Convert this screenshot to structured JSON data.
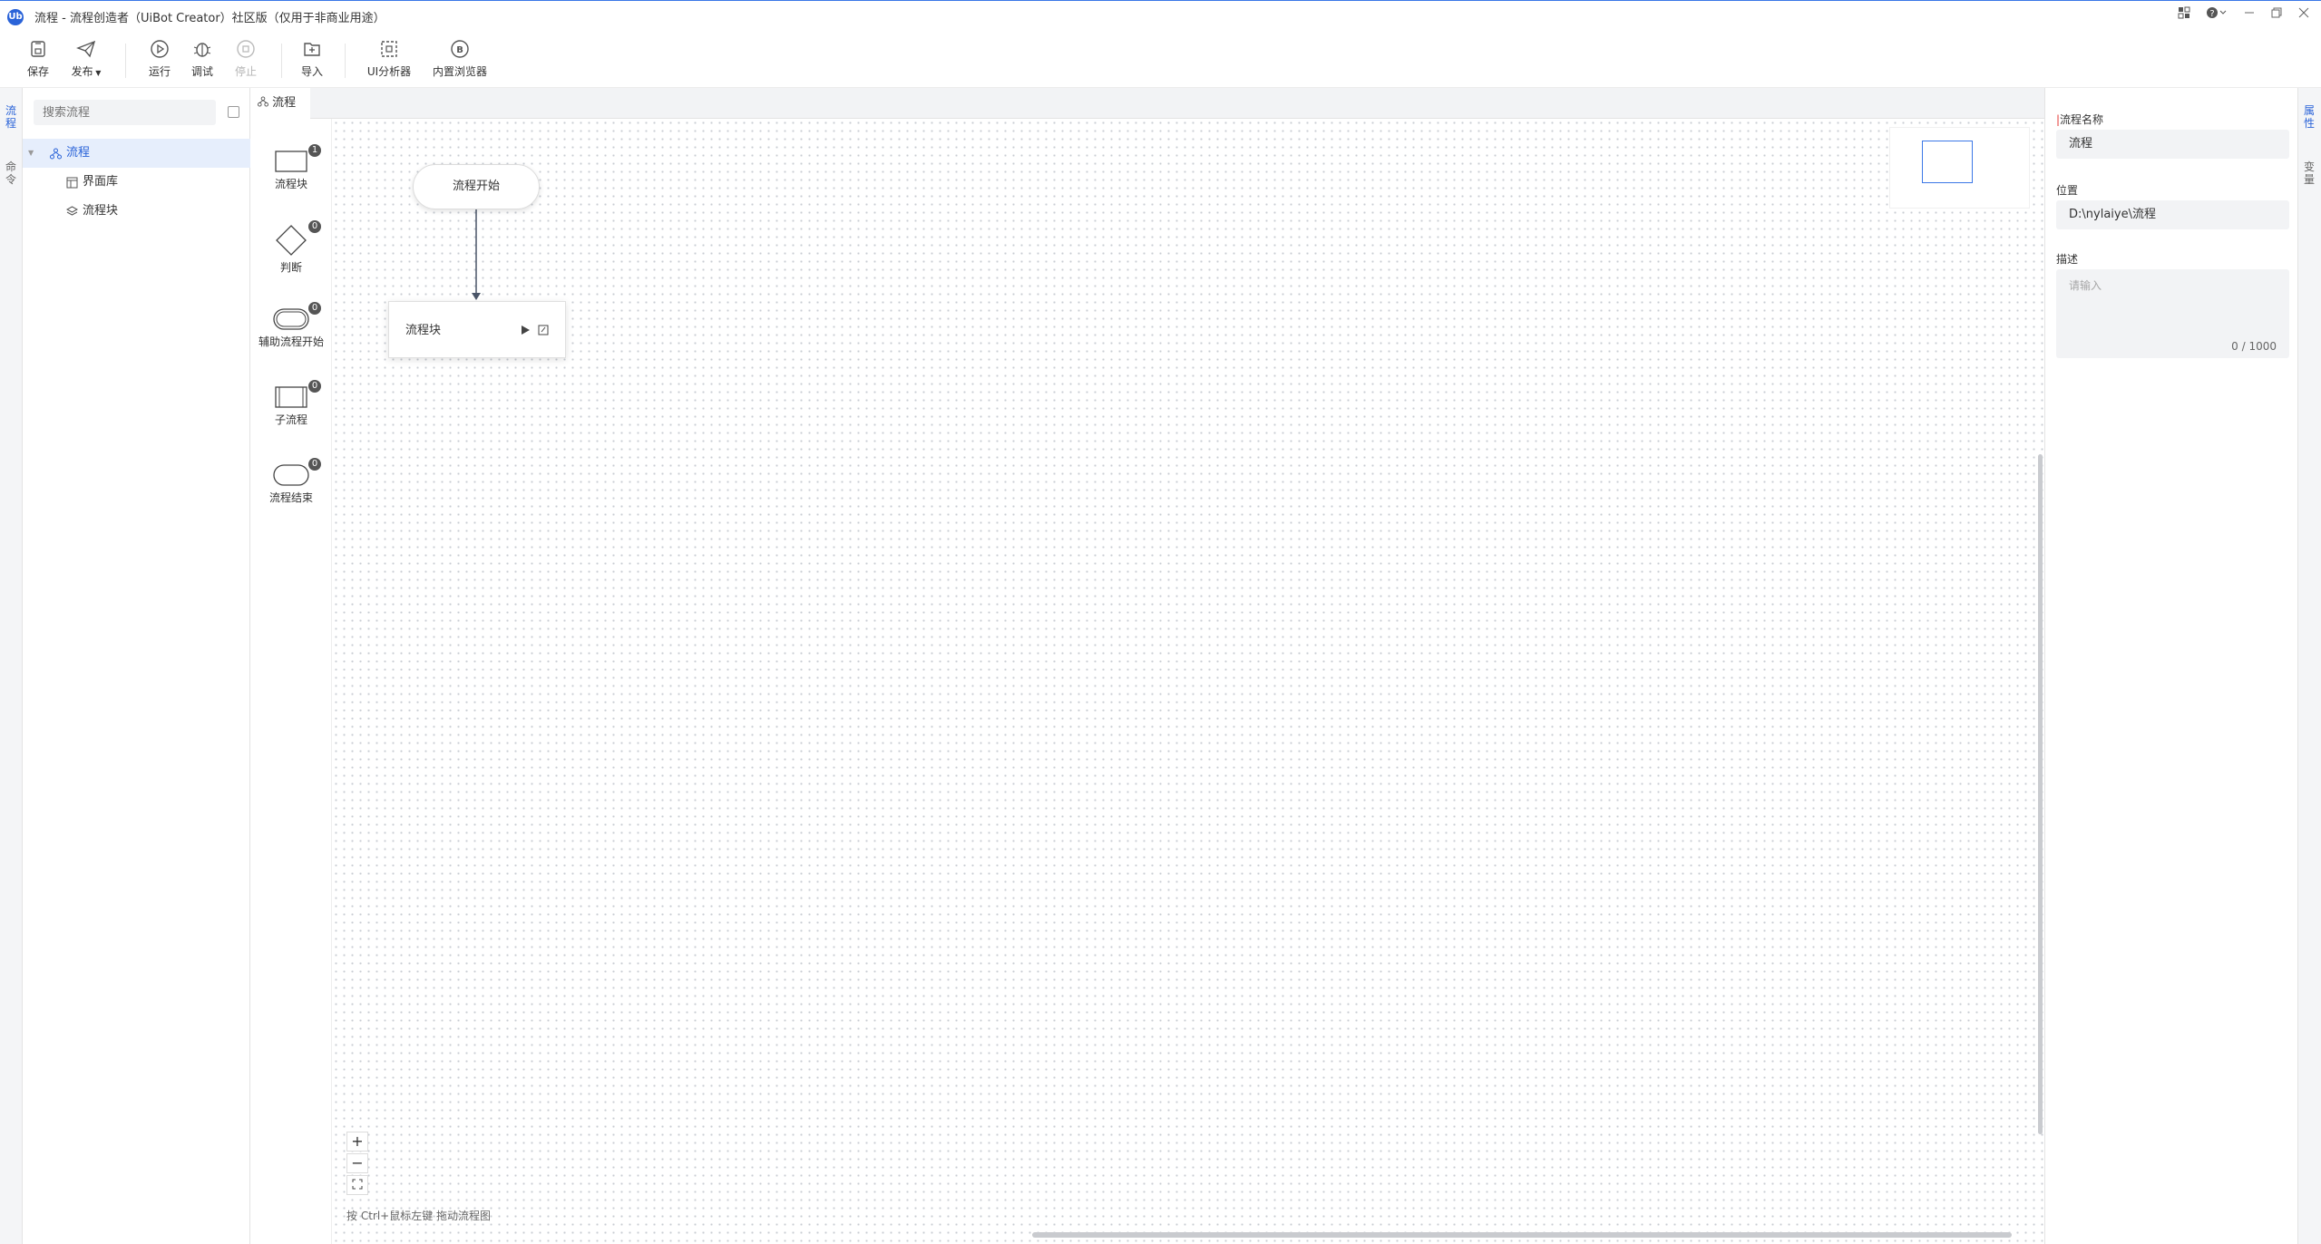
{
  "window": {
    "logo": "Ub",
    "title": "流程 - 流程创造者（UiBot Creator）社区版（仅用于非商业用途）",
    "controls": [
      "layout-icon",
      "help-icon",
      "minimize-icon",
      "restore-icon",
      "close-icon"
    ]
  },
  "toolbar": {
    "save": "保存",
    "publish": "发布",
    "run": "运行",
    "debug": "调试",
    "stop": "停止",
    "import": "导入",
    "ui_analyzer": "UI分析器",
    "browser": "内置浏览器"
  },
  "left_strip": {
    "tab1": "流程",
    "tab2": "命令"
  },
  "sidebar": {
    "search_placeholder": "搜索流程",
    "tree": [
      {
        "label": "流程",
        "selected": true,
        "icon": "flow-icon"
      },
      {
        "label": "界面库",
        "icon": "ui-library-icon"
      },
      {
        "label": "流程块",
        "icon": "layers-icon"
      }
    ]
  },
  "tabs": [
    {
      "label": "流程",
      "active": true
    }
  ],
  "palette": [
    {
      "label": "流程块",
      "count": "1"
    },
    {
      "label": "判断",
      "count": "0"
    },
    {
      "label": "辅助流程开始",
      "count": "0"
    },
    {
      "label": "子流程",
      "count": "0"
    },
    {
      "label": "流程结束",
      "count": "0"
    }
  ],
  "canvas": {
    "start_node": "流程开始",
    "block_node": "流程块",
    "zoom_in": "+",
    "zoom_out": "−",
    "hint": "按 Ctrl+鼠标左键 拖动流程图"
  },
  "properties": {
    "name_label": "流程名称",
    "name_value": "流程",
    "location_label": "位置",
    "location_value": "D:\\nylaiye\\流程",
    "desc_label": "描述",
    "desc_placeholder": "请输入",
    "desc_count": "0 / 1000"
  },
  "right_strip": {
    "tab1": "属性",
    "tab2": "变量"
  },
  "colors": {
    "accent": "#2a63d8",
    "selected_bg": "#e6eefc"
  }
}
